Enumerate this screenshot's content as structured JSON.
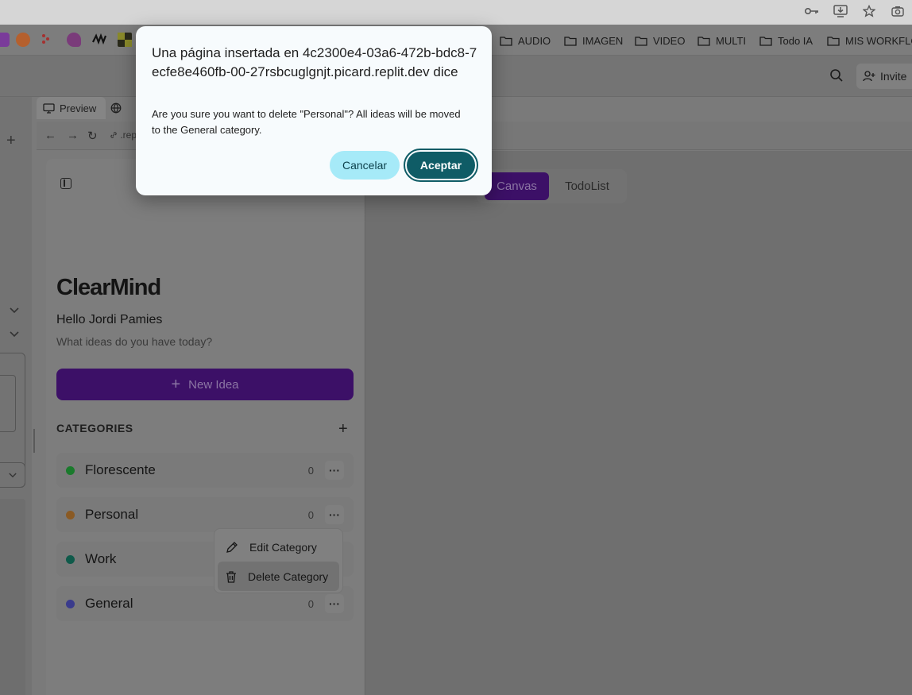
{
  "bookmarks": {
    "folders": [
      "AUDIO",
      "IMAGEN",
      "VIDEO",
      "MULTI",
      "Todo IA",
      "MIS WORKFLO"
    ]
  },
  "workspace": {
    "invite_label": "Invite",
    "tabs": [
      {
        "label": "Preview"
      }
    ],
    "url_fragment": ".rep"
  },
  "app": {
    "logo": "ClearMind",
    "greeting": "Hello Jordi Pamies",
    "subtitle": "What ideas do you have today?",
    "new_idea_label": "New Idea",
    "categories_title": "CATEGORIES",
    "categories": [
      {
        "name": "Florescente",
        "count": "0",
        "color": "#1a7a2c"
      },
      {
        "name": "Personal",
        "count": "0",
        "color": "#8a5a24"
      },
      {
        "name": "Work",
        "count": "",
        "color": "#0f5a4a"
      },
      {
        "name": "General",
        "count": "0",
        "color": "#3a3b8c"
      }
    ],
    "context_menu": {
      "edit_label": "Edit Category",
      "delete_label": "Delete Category"
    },
    "view_switch": {
      "canvas_label": "Canvas",
      "todolist_label": "TodoList"
    }
  },
  "dialog": {
    "title": "Una página insertada en 4c2300e4-03a6-472b-bdc8-7ecfe8e460fb-00-27rsbcuglgnjt.picard.replit.dev dice",
    "message": "Are you sure you want to delete \"Personal\"? All ideas will be moved to the General category.",
    "cancel_label": "Cancelar",
    "accept_label": "Aceptar"
  }
}
